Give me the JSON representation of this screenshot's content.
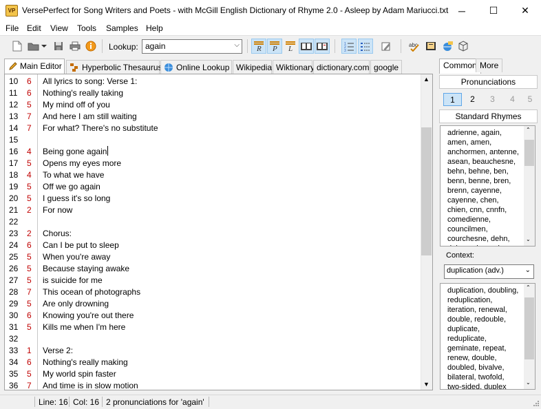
{
  "window": {
    "title": "VersePerfect for Song Writers and Poets - with McGill English Dictionary of Rhyme 2.0 - Asleep by Adam Mariucci.txt",
    "app_icon_text": "VP",
    "minimize": "─",
    "maximize": "☐",
    "close": "✕"
  },
  "menu": [
    "File",
    "Edit",
    "View",
    "Tools",
    "Samples",
    "Help"
  ],
  "toolbar": {
    "lookup_label": "Lookup:",
    "lookup_value": "again"
  },
  "tabs": [
    "Main Editor",
    "Hyperbolic Thesaurus",
    "Online Lookup",
    "Wikipedia",
    "Wiktionary",
    "dictionary.com",
    "google"
  ],
  "editor": {
    "lines": [
      {
        "n": "10",
        "s": "6",
        "t": "All lyrics to song: Verse 1:"
      },
      {
        "n": "11",
        "s": "6",
        "t": "Nothing's really taking"
      },
      {
        "n": "12",
        "s": "5",
        "t": "My mind off of you"
      },
      {
        "n": "13",
        "s": "7",
        "t": "And here I am still waiting"
      },
      {
        "n": "14",
        "s": "7",
        "t": "For what? There's no substitute"
      },
      {
        "n": "15",
        "s": "",
        "t": ""
      },
      {
        "n": "16",
        "s": "4",
        "t": "Being gone again"
      },
      {
        "n": "17",
        "s": "5",
        "t": "Opens my eyes more"
      },
      {
        "n": "18",
        "s": "4",
        "t": "To what we have"
      },
      {
        "n": "19",
        "s": "5",
        "t": "Off we go again"
      },
      {
        "n": "20",
        "s": "5",
        "t": "I guess it's so long"
      },
      {
        "n": "21",
        "s": "2",
        "t": "For now"
      },
      {
        "n": "22",
        "s": "",
        "t": ""
      },
      {
        "n": "23",
        "s": "2",
        "t": "Chorus:"
      },
      {
        "n": "24",
        "s": "6",
        "t": "Can I be put to sleep"
      },
      {
        "n": "25",
        "s": "5",
        "t": "When you're away"
      },
      {
        "n": "26",
        "s": "5",
        "t": "Because staying awake"
      },
      {
        "n": "27",
        "s": "5",
        "t": "is suicide for me"
      },
      {
        "n": "28",
        "s": "7",
        "t": "This ocean of photographs"
      },
      {
        "n": "29",
        "s": "5",
        "t": "Are only drowning"
      },
      {
        "n": "30",
        "s": "6",
        "t": "Knowing you're out there"
      },
      {
        "n": "31",
        "s": "5",
        "t": "Kills me when I'm here"
      },
      {
        "n": "32",
        "s": "",
        "t": ""
      },
      {
        "n": "33",
        "s": "1",
        "t": "Verse 2:"
      },
      {
        "n": "34",
        "s": "6",
        "t": "Nothing's really making"
      },
      {
        "n": "35",
        "s": "5",
        "t": "My world spin faster"
      },
      {
        "n": "36",
        "s": "7",
        "t": "And time is in slow motion"
      }
    ]
  },
  "status": {
    "line": "Line: 16",
    "col": "Col: 16",
    "message": "2 pronunciations for 'again'"
  },
  "side": {
    "tabs": [
      "Common",
      "More"
    ],
    "pronunciations_label": "Pronunciations",
    "pron_numbers": [
      "1",
      "2",
      "3",
      "4",
      "5"
    ],
    "standard_rhymes_label": "Standard Rhymes",
    "rhymes": [
      "adrienne, again,",
      "amen, amen,",
      "anchormen, antenne,",
      "asean, beauchesne,",
      "behn, behne, ben,",
      "benn, benne, bren,",
      "brenn, cayenne,",
      "cayenne, chen,",
      "chien, cnn, cnnfn,",
      "comedienne,",
      "councilmen,",
      "courchesne, dehn,",
      "delmonaham, den"
    ],
    "context_label": "Context:",
    "context_value": "duplication (adv.)",
    "synonyms": [
      "duplication, doubling,",
      "reduplication,",
      "iteration, renewal,",
      "double, redouble,",
      "duplicate,",
      "reduplicate,",
      "geminate, repeat,",
      "renew, double,",
      "doubled, bivalve,",
      "bilateral, twofold,",
      "two-sided, duplex"
    ]
  }
}
